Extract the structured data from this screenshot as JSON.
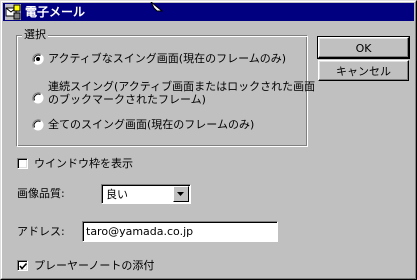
{
  "window": {
    "title": "電子メール",
    "title_icon": "mail-icon"
  },
  "group": {
    "legend": "選択",
    "options": [
      {
        "label": "アクティブなスイング画面(現在のフレームのみ)",
        "selected": true
      },
      {
        "label_line1": "連続スイング(アクティブ画面またはロックされた画面",
        "label_line2": "のブックマークされたフレーム)",
        "selected": false
      },
      {
        "label": "全てのスイング画面(現在のフレームのみ)",
        "selected": false
      }
    ]
  },
  "buttons": {
    "ok": "OK",
    "cancel": "キャンセル"
  },
  "show_frame": {
    "label": "ウインドウ枠を表示",
    "checked": false
  },
  "quality": {
    "label": "画像品質:",
    "value": "良い"
  },
  "address": {
    "label": "アドレス:",
    "value": "taro@yamada.co.jp"
  },
  "attach_note": {
    "label": "プレーヤーノートの添付",
    "checked": true
  },
  "colors": {
    "titlebar": "#000080",
    "face": "#c0c0c0"
  }
}
